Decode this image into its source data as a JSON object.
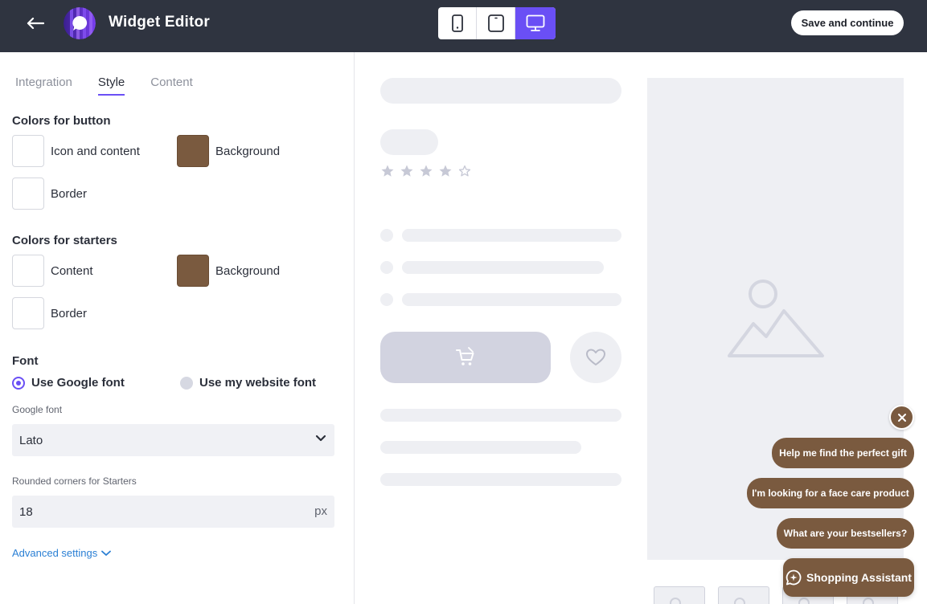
{
  "header": {
    "title": "Widget Editor",
    "save_label": "Save and continue"
  },
  "device_switch": {
    "options": [
      "mobile",
      "tablet",
      "desktop"
    ],
    "selected": "desktop"
  },
  "tabs": [
    {
      "label": "Integration",
      "active": false
    },
    {
      "label": "Style",
      "active": true
    },
    {
      "label": "Content",
      "active": false
    }
  ],
  "button_colors": {
    "title": "Colors for button",
    "icon_content": {
      "label": "Icon and content",
      "color": "#ffffff"
    },
    "background": {
      "label": "Background",
      "color": "#7a5a3f"
    },
    "border": {
      "label": "Border",
      "color": "#ffffff"
    }
  },
  "starter_colors": {
    "title": "Colors for starters",
    "content": {
      "label": "Content",
      "color": "#ffffff"
    },
    "background": {
      "label": "Background",
      "color": "#7a5a3f"
    },
    "border": {
      "label": "Border",
      "color": "#ffffff"
    }
  },
  "font": {
    "title": "Font",
    "google_option": "Use Google font",
    "website_option": "Use my website font",
    "selected": "google",
    "google_font_label": "Google font",
    "google_font_value": "Lato"
  },
  "rounded": {
    "label": "Rounded corners for Starters",
    "value": "18",
    "unit": "px"
  },
  "advanced_label": "Advanced settings",
  "widget": {
    "starters": [
      "Help me find the perfect gift",
      "I'm looking for a face care product",
      "What are your bestsellers?"
    ],
    "assistant_label": "Shopping Assistant",
    "accent_color": "#7a5a3f"
  },
  "preview": {
    "rating_stars_filled": 4,
    "rating_stars_total": 5
  },
  "colors": {
    "header_bg": "#2f3440",
    "primary": "#6a4ff5",
    "link": "#2a7fd4"
  }
}
